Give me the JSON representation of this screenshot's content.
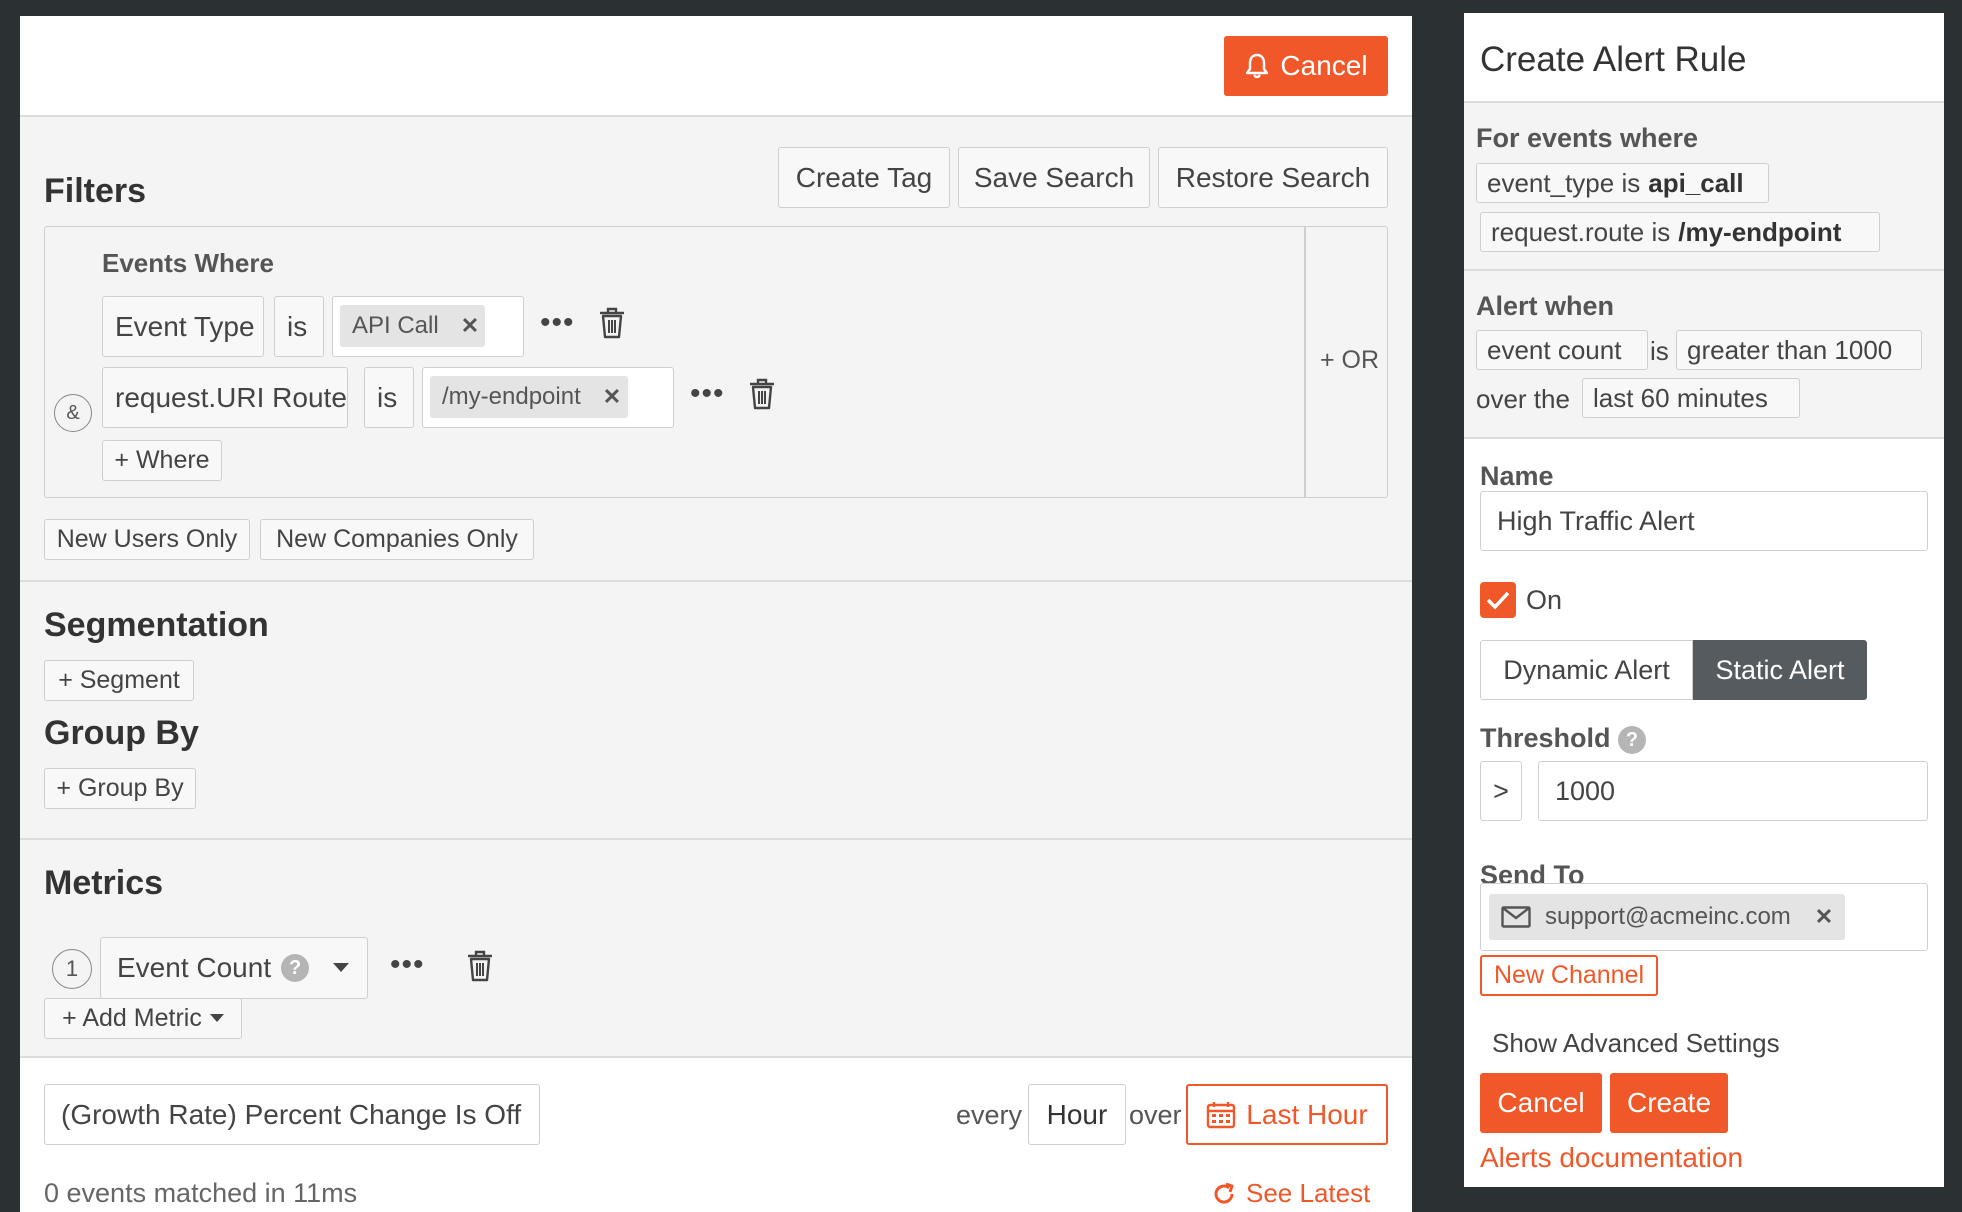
{
  "colors": {
    "accent": "#f0582a",
    "dark_toggle": "#555b5e",
    "background": "#2b3033"
  },
  "toolbar": {
    "cancel_label": "Cancel"
  },
  "filters": {
    "title": "Filters",
    "create_tag": "Create Tag",
    "save_search": "Save Search",
    "restore_search": "Restore Search",
    "events_where": "Events Where",
    "and_symbol": "&",
    "or_label": "+ OR",
    "rows": [
      {
        "field": "Event Type",
        "operator": "is",
        "value": "API Call"
      },
      {
        "field": "request.URI Route",
        "operator": "is",
        "value": "/my-endpoint"
      }
    ],
    "add_where": "+ Where",
    "new_users_only": "New Users Only",
    "new_companies_only": "New Companies Only"
  },
  "segmentation": {
    "title": "Segmentation",
    "add_segment": "+ Segment"
  },
  "group_by": {
    "title": "Group By",
    "add_group_by": "+ Group By"
  },
  "metrics": {
    "title": "Metrics",
    "items": [
      {
        "index": "1",
        "label": "Event Count"
      }
    ],
    "add_metric": "+ Add Metric"
  },
  "footer": {
    "growth_rate": "(Growth Rate) Percent Change Is Off",
    "every_label": "every",
    "interval": "Hour",
    "over_label": "over",
    "time_range": "Last Hour",
    "matched": "0 events matched in 11ms",
    "see_latest": "See Latest"
  },
  "alert": {
    "title": "Create Alert Rule",
    "for_events_where": "For events where",
    "conditions": [
      {
        "field": "event_type",
        "op": "is",
        "value": "api_call"
      },
      {
        "field": "request.route",
        "op": "is",
        "value": "/my-endpoint"
      }
    ],
    "alert_when": "Alert when",
    "metric": "event count",
    "is_label": "is",
    "comparison": "greater than 1000",
    "over_the": "over the",
    "window": "last 60 minutes",
    "name_label": "Name",
    "name_value": "High Traffic Alert",
    "on_label": "On",
    "on_checked": true,
    "dynamic_alert": "Dynamic Alert",
    "static_alert": "Static Alert",
    "selected_type": "Static Alert",
    "threshold_label": "Threshold",
    "threshold_op": ">",
    "threshold_value": "1000",
    "send_to_label": "Send To",
    "recipient": "support@acmeinc.com",
    "new_channel": "New Channel",
    "show_advanced": "Show Advanced Settings",
    "cancel": "Cancel",
    "create": "Create",
    "docs": "Alerts documentation"
  }
}
